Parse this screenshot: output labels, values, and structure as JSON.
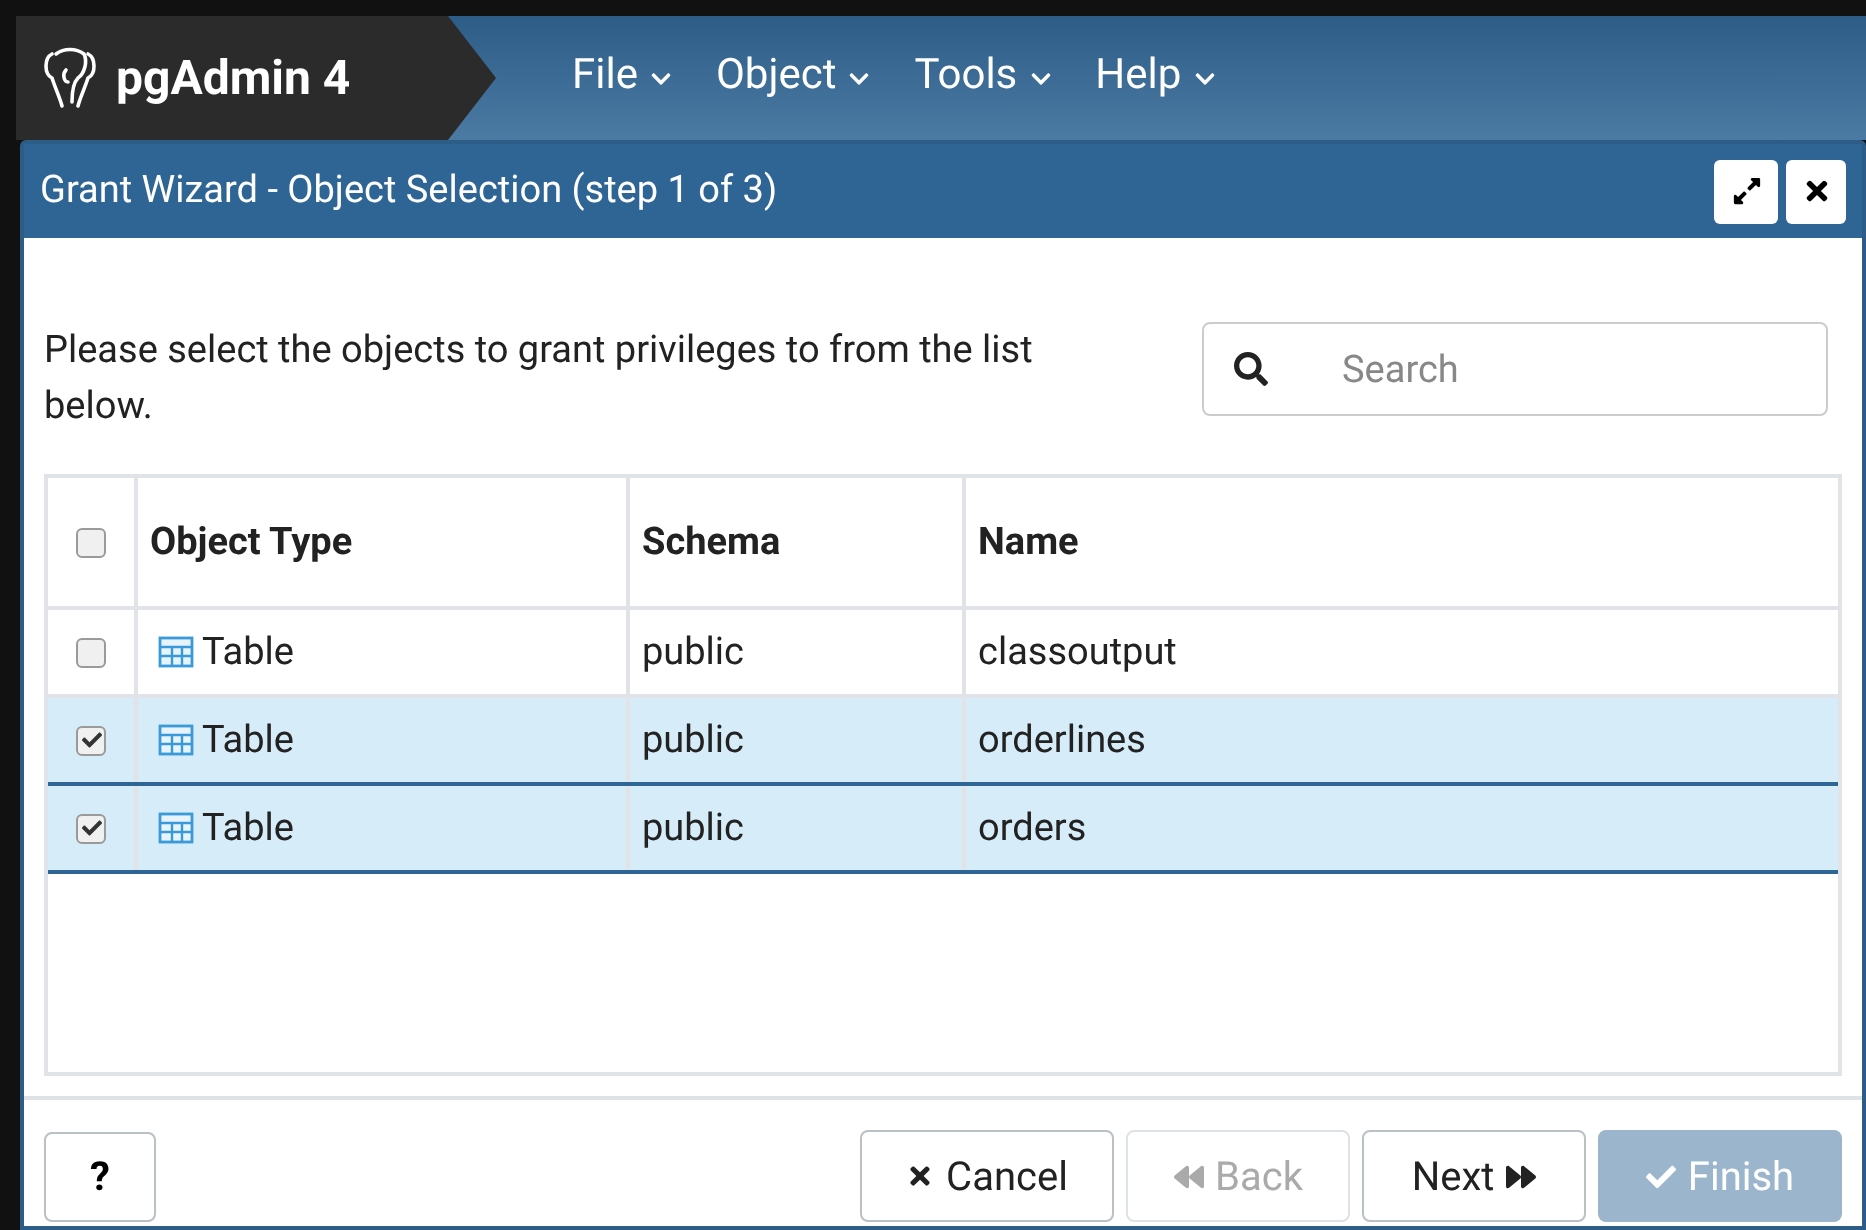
{
  "app": {
    "name": "pgAdmin 4",
    "menus": [
      {
        "label": "File"
      },
      {
        "label": "Object"
      },
      {
        "label": "Tools"
      },
      {
        "label": "Help"
      }
    ]
  },
  "dialog": {
    "title": "Grant Wizard - Object Selection (step 1 of 3)",
    "instruction": "Please select the objects to grant privileges to from the list below.",
    "search": {
      "placeholder": "Search"
    },
    "table": {
      "select_all_checked": false,
      "columns": [
        "Object Type",
        "Schema",
        "Name"
      ],
      "rows": [
        {
          "checked": false,
          "selected": false,
          "cells": [
            "Table",
            "public",
            "classoutput"
          ]
        },
        {
          "checked": true,
          "selected": true,
          "cells": [
            "Table",
            "public",
            "orderlines"
          ]
        },
        {
          "checked": true,
          "selected": true,
          "cells": [
            "Table",
            "public",
            "orders"
          ]
        }
      ]
    },
    "help_button": "?",
    "buttons": [
      {
        "label": "Cancel",
        "kind": "cancel",
        "disabled": false
      },
      {
        "label": "Back",
        "kind": "back",
        "disabled": true
      },
      {
        "label": "Next",
        "kind": "next",
        "disabled": false
      },
      {
        "label": "Finish",
        "kind": "finish",
        "disabled": true
      }
    ]
  }
}
